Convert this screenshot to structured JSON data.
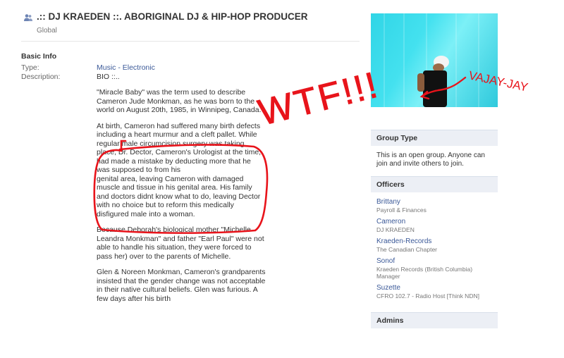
{
  "header": {
    "title": ".:: DJ KRAEDEN ::. ABORIGINAL DJ & HIP-HOP PRODUCER",
    "subtitle": "Global"
  },
  "basic_info": {
    "section_title": "Basic Info",
    "type_label": "Type:",
    "type_value": "Music - Electronic",
    "description_label": "Description:",
    "description_value": "BIO ::.."
  },
  "bio": [
    "\"Miracle Baby\" was the term used to describe Cameron Jude Monkman, as he was born to the world on August 20th, 1985, in Winnipeg, Canada.",
    "At birth, Cameron had suffered many birth defects including a heart murmur and a cleft pallet. While regular male circumcision surgery was taking place, Dr. Dector, Cameron's Urologist at the time, had made a mistake by deducting more that he was supposed to from his",
    "genital area, leaving Cameron with damaged muscle and tissue in his genital area. His family and doctors didnt know what to do, leaving Dector with no choice but to reform this medically disfigured male into a woman.",
    "Because Deborah's biological mother \"Michelle Leandra Monkman\" and father \"Earl Paul\" were not able to handle his situation, they were forced to pass her) over to the parents of Michelle.",
    "Glen & Noreen Monkman, Cameron's grandparents",
    "insisted that the gender change was not acceptable in their native cultural beliefs. Glen was furious. A few days after his birth"
  ],
  "annotations": {
    "wtf": "WTF!!!",
    "vajay": "VAJAY-JAY",
    "color": "#e8141b"
  },
  "sidebar": {
    "group_type": {
      "title": "Group Type",
      "text": "This is an open group. Anyone can join and invite others to join."
    },
    "officers": {
      "title": "Officers",
      "items": [
        {
          "name": "Brittany",
          "role": "Payroll & Finances"
        },
        {
          "name": "Cameron",
          "role": "DJ KRAEDEN"
        },
        {
          "name": "Kraeden-Records",
          "role": "The Canadian Chapter"
        },
        {
          "name": "Sonof",
          "role": "Kraeden Records (British Columbia) Manager"
        },
        {
          "name": "Suzette",
          "role": "CFRO 102.7 - Radio Host [Think NDN]"
        }
      ]
    },
    "admins": {
      "title": "Admins"
    }
  },
  "colors": {
    "link": "#3b5998",
    "box_head": "#eceff5",
    "photo": "#44e1ef"
  }
}
